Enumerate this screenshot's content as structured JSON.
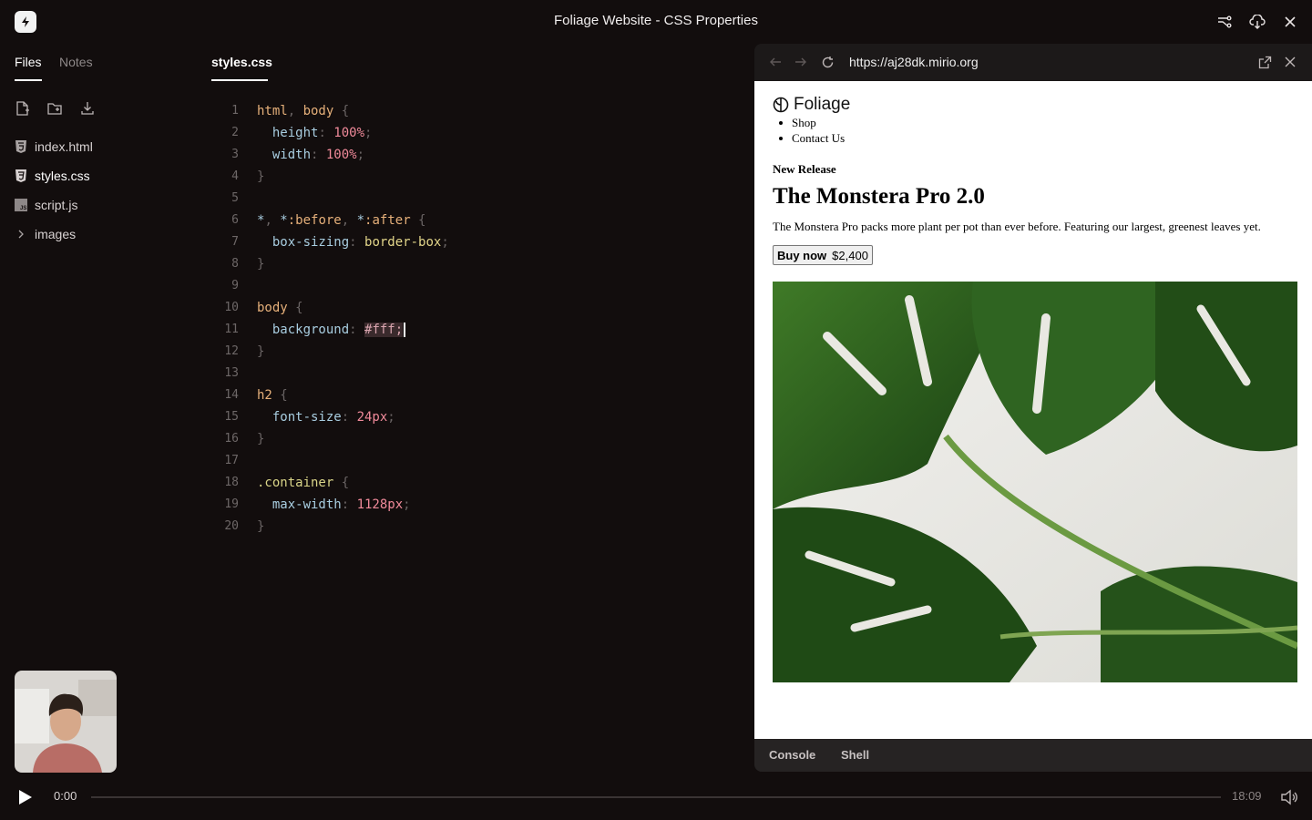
{
  "window": {
    "title": "Foliage Website - CSS Properties"
  },
  "sidebar": {
    "tabs": [
      {
        "label": "Files",
        "active": true
      },
      {
        "label": "Notes",
        "active": false
      }
    ],
    "files": [
      {
        "name": "index.html",
        "icon": "html5-icon"
      },
      {
        "name": "styles.css",
        "icon": "css3-icon"
      },
      {
        "name": "script.js",
        "icon": "js-icon"
      },
      {
        "name": "images",
        "icon": "chevron-right-icon"
      }
    ]
  },
  "editor": {
    "active_tab": "styles.css",
    "lines": [
      [
        [
          "sel",
          "html"
        ],
        [
          "punc",
          ", "
        ],
        [
          "sel",
          "body"
        ],
        [
          "punc",
          " {"
        ]
      ],
      [
        [
          "pl",
          "  "
        ],
        [
          "prop",
          "height"
        ],
        [
          "punc",
          ": "
        ],
        [
          "num",
          "100%"
        ],
        [
          "punc",
          ";"
        ]
      ],
      [
        [
          "pl",
          "  "
        ],
        [
          "prop",
          "width"
        ],
        [
          "punc",
          ": "
        ],
        [
          "num",
          "100%"
        ],
        [
          "punc",
          ";"
        ]
      ],
      [
        [
          "punc",
          "}"
        ]
      ],
      [],
      [
        [
          "prop",
          "*"
        ],
        [
          "punc",
          ", "
        ],
        [
          "prop",
          "*"
        ],
        [
          "sel",
          ":before"
        ],
        [
          "punc",
          ", "
        ],
        [
          "prop",
          "*"
        ],
        [
          "sel",
          ":after"
        ],
        [
          "punc",
          " {"
        ]
      ],
      [
        [
          "pl",
          "  "
        ],
        [
          "prop",
          "box-sizing"
        ],
        [
          "punc",
          ": "
        ],
        [
          "val",
          "border-box"
        ],
        [
          "punc",
          ";"
        ]
      ],
      [
        [
          "punc",
          "}"
        ]
      ],
      [],
      [
        [
          "sel",
          "body"
        ],
        [
          "punc",
          " {"
        ]
      ],
      [
        [
          "pl",
          "  "
        ],
        [
          "prop",
          "background"
        ],
        [
          "punc",
          ": "
        ],
        [
          "hex",
          "#fff;"
        ],
        [
          "caret",
          ""
        ]
      ],
      [
        [
          "punc",
          "}"
        ]
      ],
      [],
      [
        [
          "sel",
          "h2"
        ],
        [
          "punc",
          " {"
        ]
      ],
      [
        [
          "pl",
          "  "
        ],
        [
          "prop",
          "font-size"
        ],
        [
          "punc",
          ": "
        ],
        [
          "num",
          "24px"
        ],
        [
          "punc",
          ";"
        ]
      ],
      [
        [
          "punc",
          "}"
        ]
      ],
      [],
      [
        [
          "class",
          ".container"
        ],
        [
          "punc",
          " {"
        ]
      ],
      [
        [
          "pl",
          "  "
        ],
        [
          "prop",
          "max-width"
        ],
        [
          "punc",
          ": "
        ],
        [
          "num",
          "1128px"
        ],
        [
          "punc",
          ";"
        ]
      ],
      [
        [
          "punc",
          "}"
        ]
      ]
    ]
  },
  "browser": {
    "url": "https://aj28dk.mirio.org",
    "site": {
      "logo": "Foliage",
      "nav": [
        "Shop",
        "Contact Us"
      ],
      "eyebrow": "New Release",
      "headline": "The Monstera Pro 2.0",
      "description": "The Monstera Pro packs more plant per pot than ever before. Featuring our largest, greenest leaves yet.",
      "buy_label": "Buy now",
      "price": "$2,400"
    },
    "devtools_tabs": [
      "Console",
      "Shell"
    ]
  },
  "player": {
    "current_time": "0:00",
    "total_time": "18:09",
    "progress": 0
  },
  "colors": {
    "background": "#120d0d",
    "selector": "#e6b07a",
    "property": "#a8cde0",
    "number": "#f08a9a",
    "value": "#e3d68a"
  }
}
